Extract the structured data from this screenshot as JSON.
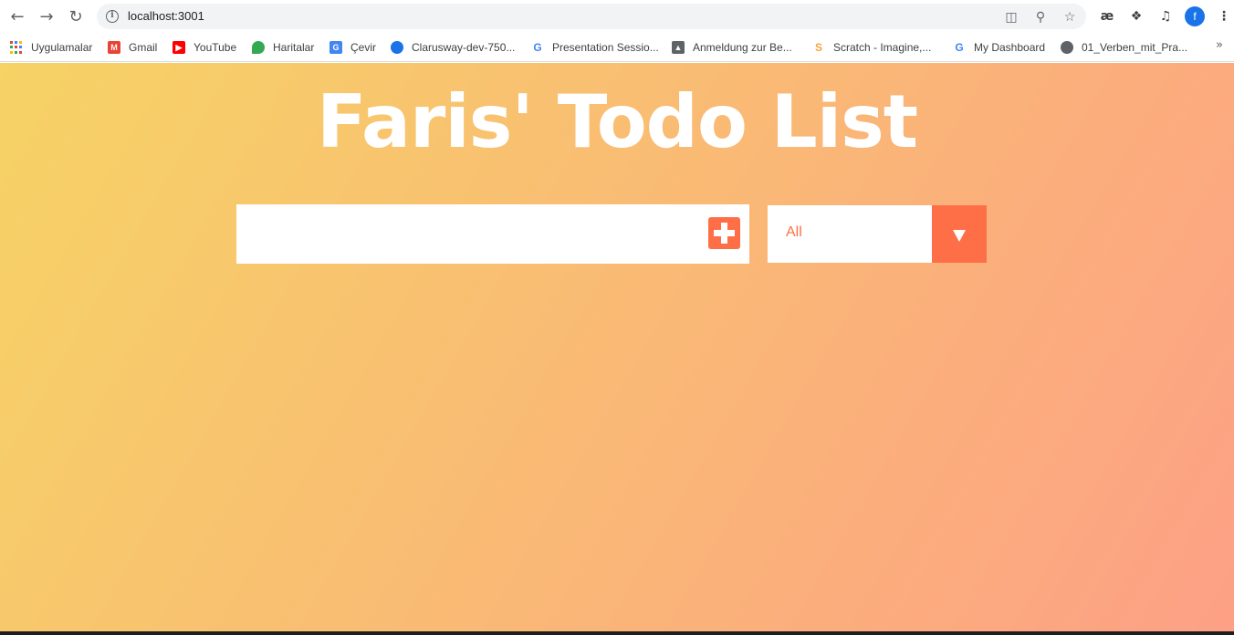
{
  "browser": {
    "url": "localhost:3001",
    "profile_initial": "f",
    "toolbar_icons": [
      "back-icon",
      "forward-icon",
      "reload-icon",
      "translate-icon",
      "zoom-icon",
      "star-icon",
      "ae-extension-icon",
      "puzzle-icon",
      "media-icon",
      "menu-icon"
    ],
    "ae_label": "æ",
    "bookmarks": [
      {
        "label": "Uygulamalar",
        "icon": "apps-icon"
      },
      {
        "label": "Gmail",
        "icon": "gmail-icon",
        "color": "#ea4335"
      },
      {
        "label": "YouTube",
        "icon": "youtube-icon",
        "color": "#ff0000"
      },
      {
        "label": "Haritalar",
        "icon": "maps-icon",
        "color": "#34a853"
      },
      {
        "label": "Çevir",
        "icon": "translate-icon",
        "color": "#4285f4"
      },
      {
        "label": "Clarusway-dev-750...",
        "icon": "circle-icon",
        "color": "#1a73e8"
      },
      {
        "label": "Presentation Sessio...",
        "icon": "google-icon",
        "color": "#4285f4"
      },
      {
        "label": "Anmeldung zur Be...",
        "icon": "graduation-icon",
        "color": "#5f6368"
      },
      {
        "label": "Scratch - Imagine,...",
        "icon": "scratch-icon",
        "color": "#f7a43b"
      },
      {
        "label": "My Dashboard",
        "icon": "google-icon",
        "color": "#4285f4"
      },
      {
        "label": "01_Verben_mit_Pra...",
        "icon": "globe-icon",
        "color": "#5f6368"
      }
    ],
    "more_label": "»"
  },
  "app": {
    "title": "Faris' Todo List",
    "input_value": "",
    "filter": {
      "selected": "All"
    },
    "colors": {
      "gradient_start": "#f6d365",
      "gradient_end": "#fda085",
      "accent": "#ff6f47"
    }
  }
}
